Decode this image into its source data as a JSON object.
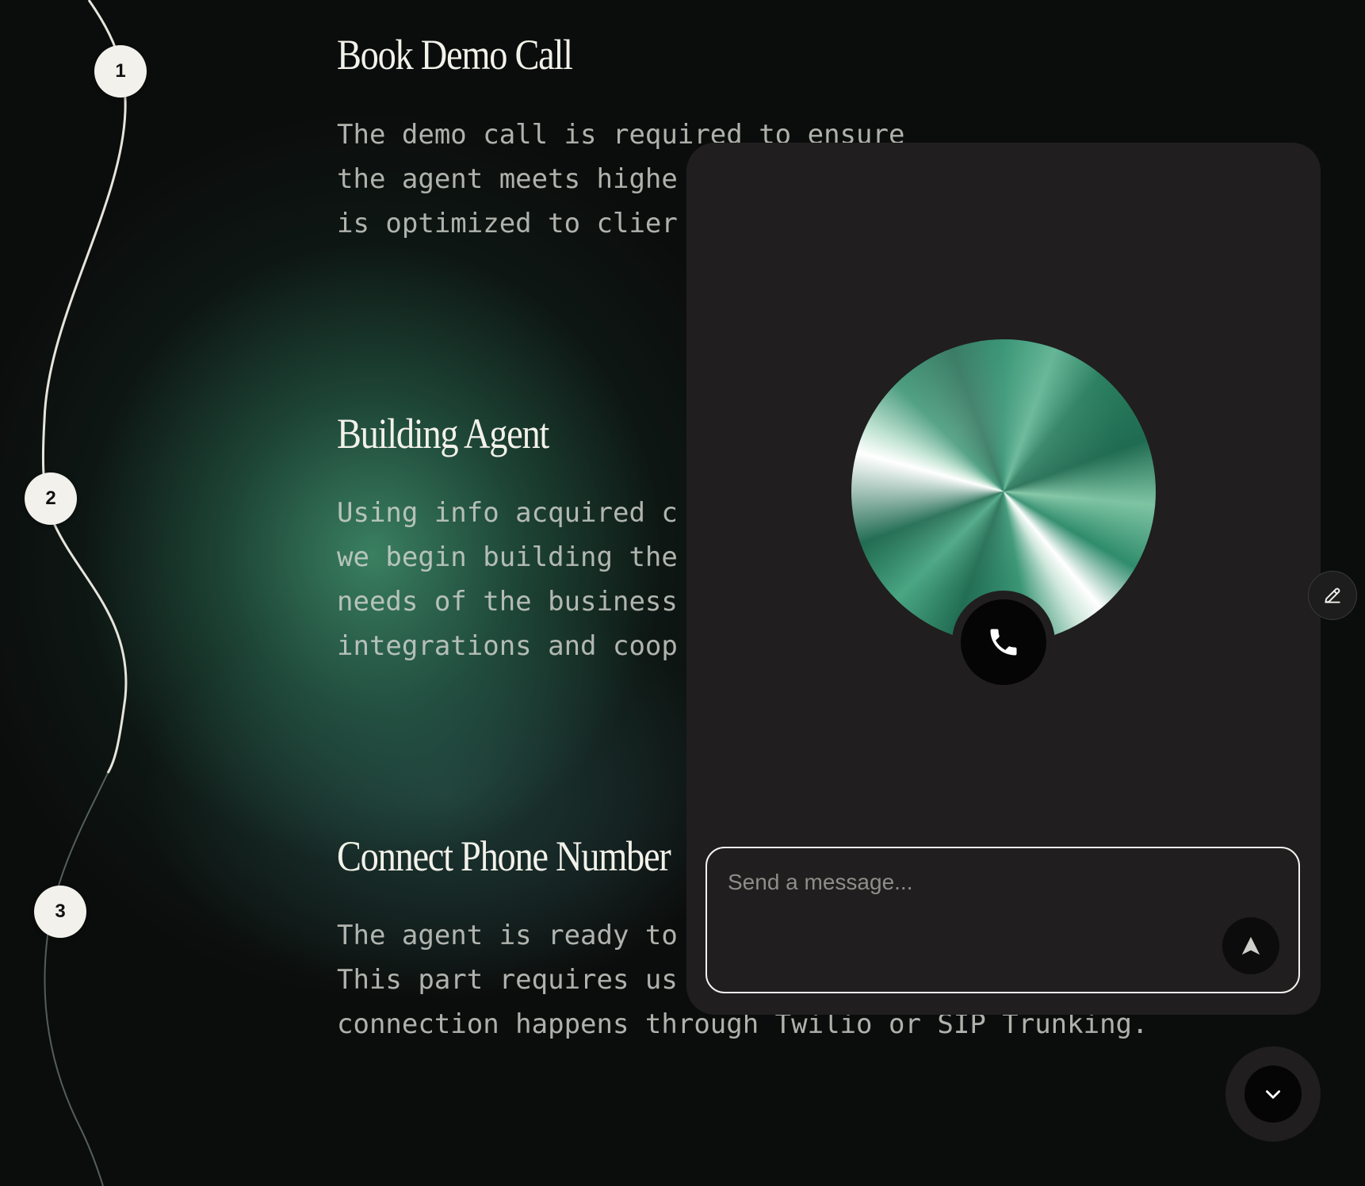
{
  "steps": [
    {
      "number": "1",
      "title": "Book Demo Call",
      "body": "The demo call is required to ensure\nthe agent meets highe\nis optimized to clier"
    },
    {
      "number": "2",
      "title": "Building Agent",
      "body": "Using info acquired c\nwe begin building the\nneeds of the business\nintegrations and coop"
    },
    {
      "number": "3",
      "title": "Connect Phone Number",
      "body": "The agent is ready to\nThis part requires us\nconnection happens through Twilio or SIP Trunking."
    }
  ],
  "chat": {
    "message_placeholder": "Send a message...",
    "call_icon": "phone-icon",
    "send_icon": "send-icon",
    "edit_icon": "pencil-icon",
    "collapse_icon": "chevron-down-icon"
  },
  "colors": {
    "background": "#0b0d0c",
    "glow": "#429470",
    "panel": "#201e1e",
    "accent": "#2d8f6e"
  }
}
